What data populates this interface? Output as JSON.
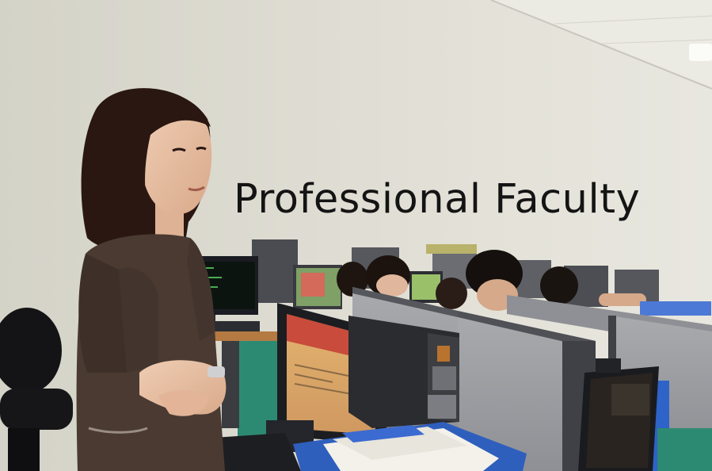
{
  "caption": "Professional Faculty",
  "scene": {
    "subject": "woman standing with arms crossed in a computer lab",
    "objects": [
      "ceiling-light",
      "office-chair",
      "cubicle-partitions",
      "crt-monitor",
      "computer-tower",
      "keyboard",
      "student-group",
      "document-folder"
    ]
  },
  "colors": {
    "wall": "#dfddd3",
    "ceiling": "#e9e8e1",
    "partition_gray": "#9d9ea4",
    "partition_frame": "#3f4146",
    "shirt": "#4a3a32",
    "hair": "#2a1a14",
    "folder_blue": "#2f5fbd",
    "screen_orange": "#d9a36a",
    "floor_teal": "#2d8a72"
  }
}
